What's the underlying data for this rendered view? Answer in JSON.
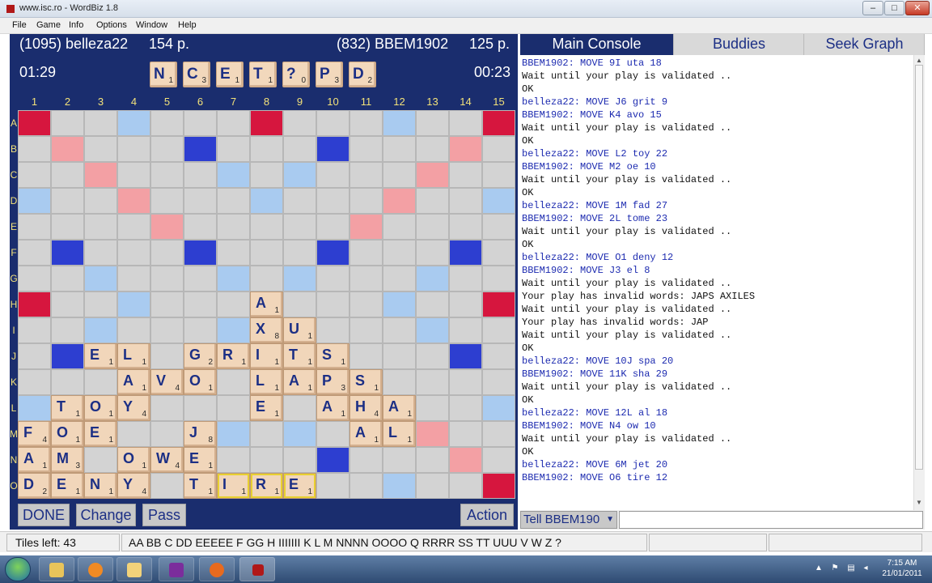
{
  "window": {
    "title": "www.isc.ro - WordBiz 1.8",
    "controls": [
      "–",
      "□",
      "✕"
    ]
  },
  "menu": [
    "File",
    "Game",
    "Info",
    "Options",
    "Window",
    "Help"
  ],
  "players": {
    "left": {
      "name": "(1095) belleza22",
      "score": "154 p.",
      "clock": "01:29"
    },
    "right": {
      "name": "(832) BBEM1902",
      "score": "125 p.",
      "clock": "00:23"
    }
  },
  "rack": [
    {
      "letter": "N",
      "points": "1"
    },
    {
      "letter": "C",
      "points": "3"
    },
    {
      "letter": "E",
      "points": "1"
    },
    {
      "letter": "T",
      "points": "1"
    },
    {
      "letter": "?",
      "points": "0"
    },
    {
      "letter": "P",
      "points": "3"
    },
    {
      "letter": "D",
      "points": "2"
    }
  ],
  "columns": [
    "1",
    "2",
    "3",
    "4",
    "5",
    "6",
    "7",
    "8",
    "9",
    "10",
    "11",
    "12",
    "13",
    "14",
    "15"
  ],
  "rows": [
    "A",
    "B",
    "C",
    "D",
    "E",
    "F",
    "G",
    "H",
    "I",
    "J",
    "K",
    "L",
    "M",
    "N",
    "O"
  ],
  "premium_squares": [
    "TW.....dL..DW..TW",
    "x"
  ],
  "board_tiles": [
    {
      "row": 7,
      "col": 7,
      "letter": "A",
      "points": "1"
    },
    {
      "row": 8,
      "col": 7,
      "letter": "X",
      "points": "8"
    },
    {
      "row": 8,
      "col": 8,
      "letter": "U",
      "points": "1"
    },
    {
      "row": 9,
      "col": 2,
      "letter": "E",
      "points": "1"
    },
    {
      "row": 9,
      "col": 3,
      "letter": "L",
      "points": "1"
    },
    {
      "row": 9,
      "col": 5,
      "letter": "G",
      "points": "2"
    },
    {
      "row": 9,
      "col": 6,
      "letter": "R",
      "points": "1"
    },
    {
      "row": 9,
      "col": 7,
      "letter": "I",
      "points": "1"
    },
    {
      "row": 9,
      "col": 8,
      "letter": "T",
      "points": "1"
    },
    {
      "row": 9,
      "col": 9,
      "letter": "S",
      "points": "1"
    },
    {
      "row": 10,
      "col": 3,
      "letter": "A",
      "points": "1"
    },
    {
      "row": 10,
      "col": 4,
      "letter": "V",
      "points": "4"
    },
    {
      "row": 10,
      "col": 5,
      "letter": "O",
      "points": "1"
    },
    {
      "row": 10,
      "col": 7,
      "letter": "L",
      "points": "1"
    },
    {
      "row": 10,
      "col": 8,
      "letter": "A",
      "points": "1"
    },
    {
      "row": 10,
      "col": 9,
      "letter": "P",
      "points": "3"
    },
    {
      "row": 10,
      "col": 10,
      "letter": "S",
      "points": "1"
    },
    {
      "row": 11,
      "col": 1,
      "letter": "T",
      "points": "1"
    },
    {
      "row": 11,
      "col": 2,
      "letter": "O",
      "points": "1"
    },
    {
      "row": 11,
      "col": 3,
      "letter": "Y",
      "points": "4"
    },
    {
      "row": 11,
      "col": 7,
      "letter": "E",
      "points": "1"
    },
    {
      "row": 11,
      "col": 9,
      "letter": "A",
      "points": "1"
    },
    {
      "row": 11,
      "col": 10,
      "letter": "H",
      "points": "4"
    },
    {
      "row": 11,
      "col": 11,
      "letter": "A",
      "points": "1"
    },
    {
      "row": 12,
      "col": 0,
      "letter": "F",
      "points": "4"
    },
    {
      "row": 12,
      "col": 1,
      "letter": "O",
      "points": "1"
    },
    {
      "row": 12,
      "col": 2,
      "letter": "E",
      "points": "1"
    },
    {
      "row": 12,
      "col": 5,
      "letter": "J",
      "points": "8"
    },
    {
      "row": 12,
      "col": 10,
      "letter": "A",
      "points": "1"
    },
    {
      "row": 12,
      "col": 11,
      "letter": "L",
      "points": "1"
    },
    {
      "row": 13,
      "col": 0,
      "letter": "A",
      "points": "1"
    },
    {
      "row": 13,
      "col": 1,
      "letter": "M",
      "points": "3"
    },
    {
      "row": 13,
      "col": 3,
      "letter": "O",
      "points": "1"
    },
    {
      "row": 13,
      "col": 4,
      "letter": "W",
      "points": "4"
    },
    {
      "row": 13,
      "col": 5,
      "letter": "E",
      "points": "1"
    },
    {
      "row": 14,
      "col": 0,
      "letter": "D",
      "points": "2"
    },
    {
      "row": 14,
      "col": 1,
      "letter": "E",
      "points": "1"
    },
    {
      "row": 14,
      "col": 2,
      "letter": "N",
      "points": "1"
    },
    {
      "row": 14,
      "col": 3,
      "letter": "Y",
      "points": "4"
    },
    {
      "row": 14,
      "col": 5,
      "letter": "T",
      "points": "1"
    },
    {
      "row": 14,
      "col": 6,
      "letter": "I",
      "points": "1",
      "last": true
    },
    {
      "row": 14,
      "col": 7,
      "letter": "R",
      "points": "1",
      "last": true
    },
    {
      "row": 14,
      "col": 8,
      "letter": "E",
      "points": "1",
      "last": true
    }
  ],
  "buttons": {
    "done": "DONE",
    "change": "Change",
    "pass": "Pass",
    "action": "Action"
  },
  "tabs": [
    "Main Console",
    "Buddies",
    "Seek Graph"
  ],
  "console_lines": [
    {
      "text": "BBEM1902: MOVE 9I uta 18",
      "kind": "move"
    },
    {
      "text": "Wait until your play is validated ..",
      "kind": "sys"
    },
    {
      "text": "OK",
      "kind": "sys"
    },
    {
      "text": "belleza22: MOVE J6 grit 9",
      "kind": "move"
    },
    {
      "text": "BBEM1902: MOVE K4 avo 15",
      "kind": "move"
    },
    {
      "text": "Wait until your play is validated ..",
      "kind": "sys"
    },
    {
      "text": "OK",
      "kind": "sys"
    },
    {
      "text": "belleza22: MOVE L2 toy 22",
      "kind": "move"
    },
    {
      "text": "BBEM1902: MOVE M2 oe 10",
      "kind": "move"
    },
    {
      "text": "Wait until your play is validated ..",
      "kind": "sys"
    },
    {
      "text": "OK",
      "kind": "sys"
    },
    {
      "text": "belleza22: MOVE 1M fad 27",
      "kind": "move"
    },
    {
      "text": "BBEM1902: MOVE 2L tome 23",
      "kind": "move"
    },
    {
      "text": "Wait until your play is validated ..",
      "kind": "sys"
    },
    {
      "text": "OK",
      "kind": "sys"
    },
    {
      "text": "belleza22: MOVE O1 deny 12",
      "kind": "move"
    },
    {
      "text": "BBEM1902: MOVE J3 el 8",
      "kind": "move"
    },
    {
      "text": "Wait until your play is validated ..",
      "kind": "sys"
    },
    {
      "text": "Your play has invalid words: JAPS AXILES",
      "kind": "sys"
    },
    {
      "text": "Wait until your play is validated ..",
      "kind": "sys"
    },
    {
      "text": "Your play has invalid words: JAP",
      "kind": "sys"
    },
    {
      "text": "Wait until your play is validated ..",
      "kind": "sys"
    },
    {
      "text": "OK",
      "kind": "sys"
    },
    {
      "text": "belleza22: MOVE 10J spa 20",
      "kind": "move"
    },
    {
      "text": "BBEM1902: MOVE 11K sha 29",
      "kind": "move"
    },
    {
      "text": "Wait until your play is validated ..",
      "kind": "sys"
    },
    {
      "text": "OK",
      "kind": "sys"
    },
    {
      "text": "belleza22: MOVE 12L al 18",
      "kind": "move"
    },
    {
      "text": "BBEM1902: MOVE N4 ow 10",
      "kind": "move"
    },
    {
      "text": "Wait until your play is validated ..",
      "kind": "sys"
    },
    {
      "text": "OK",
      "kind": "sys"
    },
    {
      "text": "belleza22: MOVE 6M jet 20",
      "kind": "move"
    },
    {
      "text": "BBEM1902: MOVE O6 tire 12",
      "kind": "move"
    }
  ],
  "tell": {
    "target": "Tell BBEM190",
    "value": ""
  },
  "status": {
    "tiles_left": "Tiles left: 43",
    "pool": "AA BB C DD EEEEE F GG H IIIIIII K L M NNNN OOOO Q RRRR SS TT UUU V W Z ?"
  },
  "tray": {
    "time": "7:15 AM",
    "date": "21/01/2011"
  },
  "colors": {
    "panel": "#1a2d6e",
    "triple_word": "#d6163e",
    "double_word": "#f3a0a4",
    "triple_letter": "#2d3ed0",
    "double_letter": "#a9cbf0",
    "tile": "#f1d6ba",
    "letter": "#1c2f85"
  }
}
